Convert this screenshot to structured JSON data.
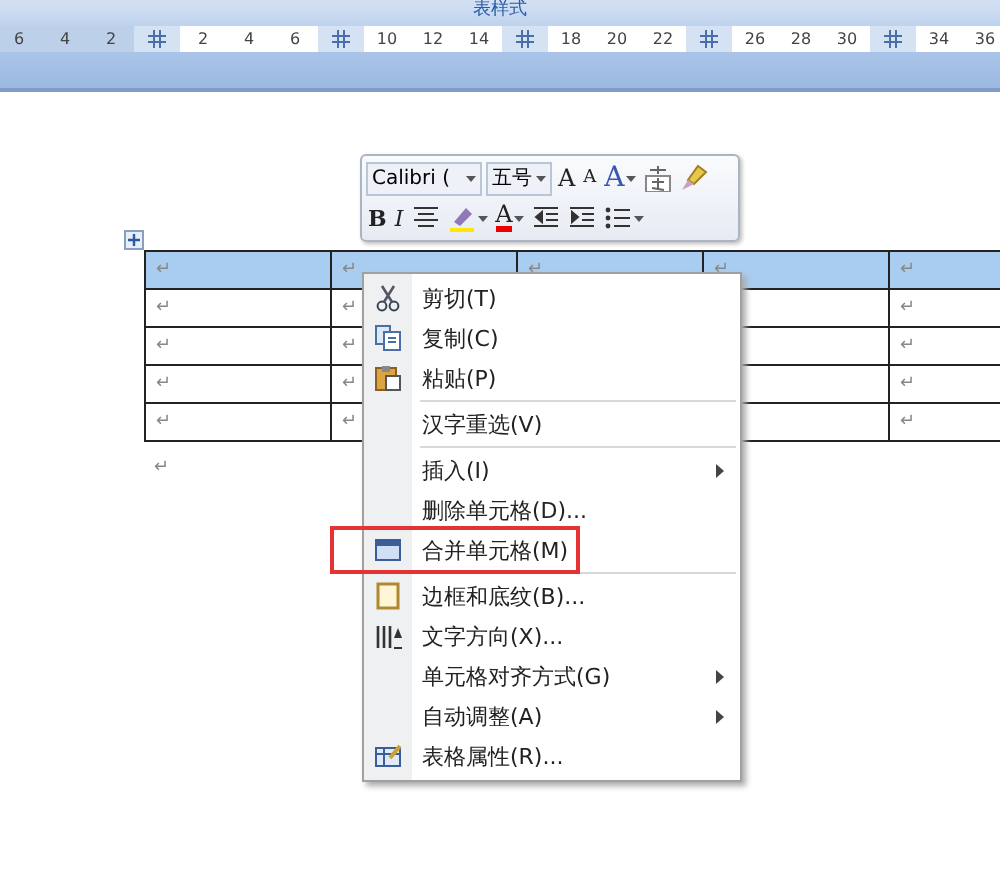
{
  "title": "表样式",
  "ruler": [
    {
      "kind": "number",
      "text": "6"
    },
    {
      "kind": "number",
      "text": "4"
    },
    {
      "kind": "number",
      "text": "2"
    },
    {
      "kind": "grid"
    },
    {
      "kind": "number",
      "text": "2"
    },
    {
      "kind": "number",
      "text": "4"
    },
    {
      "kind": "number",
      "text": "6"
    },
    {
      "kind": "grid"
    },
    {
      "kind": "number",
      "text": "10"
    },
    {
      "kind": "number",
      "text": "12"
    },
    {
      "kind": "number",
      "text": "14"
    },
    {
      "kind": "grid"
    },
    {
      "kind": "number",
      "text": "18"
    },
    {
      "kind": "number",
      "text": "20"
    },
    {
      "kind": "number",
      "text": "22"
    },
    {
      "kind": "grid"
    },
    {
      "kind": "number",
      "text": "26"
    },
    {
      "kind": "number",
      "text": "28"
    },
    {
      "kind": "number",
      "text": "30"
    },
    {
      "kind": "grid"
    },
    {
      "kind": "number",
      "text": "34"
    },
    {
      "kind": "number",
      "text": "36"
    }
  ],
  "mini_toolbar": {
    "font_row": [
      {
        "kind": "combo",
        "text": "Calibri ("
      },
      {
        "kind": "combo",
        "text": "五号"
      },
      {
        "kind": "text",
        "text": "A"
      },
      {
        "kind": "text",
        "text": "A"
      },
      {
        "kind": "text",
        "text": "A",
        "dropdown": true
      },
      {
        "kind": "icon"
      },
      {
        "kind": "icon"
      }
    ],
    "format_row": [
      {
        "kind": "text",
        "text": "B"
      },
      {
        "kind": "text",
        "text": "I"
      },
      {
        "kind": "icon"
      },
      {
        "kind": "icon",
        "dropdown": true
      },
      {
        "kind": "text",
        "text": "A",
        "dropdown": true
      },
      {
        "kind": "icon"
      },
      {
        "kind": "icon"
      },
      {
        "kind": "icon",
        "dropdown": true
      }
    ]
  },
  "table": {
    "rows": [
      {
        "selected": true,
        "cells": [
          "↵",
          "↵",
          "↵",
          "↵",
          "↵"
        ]
      },
      {
        "selected": false,
        "cells": [
          "↵",
          "↵",
          null,
          null,
          "↵"
        ]
      },
      {
        "selected": false,
        "cells": [
          "↵",
          "↵",
          null,
          null,
          "↵"
        ]
      },
      {
        "selected": false,
        "cells": [
          "↵",
          "↵",
          null,
          null,
          "↵"
        ]
      },
      {
        "selected": false,
        "cells": [
          "↵",
          "↵",
          null,
          null,
          "↵"
        ]
      }
    ]
  },
  "after_table": "↵",
  "context_menu": [
    {
      "kind": "item",
      "label": "剪切(T)"
    },
    {
      "kind": "item",
      "label": "复制(C)"
    },
    {
      "kind": "item",
      "label": "粘贴(P)"
    },
    {
      "kind": "separator"
    },
    {
      "kind": "item",
      "label": "汉字重选(V)"
    },
    {
      "kind": "separator"
    },
    {
      "kind": "item",
      "label": "插入(I)",
      "submenu": true
    },
    {
      "kind": "item",
      "label": "删除单元格(D)..."
    },
    {
      "kind": "item",
      "label": "合并单元格(M)",
      "marked": true
    },
    {
      "kind": "separator"
    },
    {
      "kind": "item",
      "label": "边框和底纹(B)..."
    },
    {
      "kind": "item",
      "label": "文字方向(X)..."
    },
    {
      "kind": "item",
      "label": "单元格对齐方式(G)",
      "submenu": true
    },
    {
      "kind": "item",
      "label": "自动调整(A)",
      "submenu": true
    },
    {
      "kind": "item",
      "label": "表格属性(R)..."
    }
  ]
}
